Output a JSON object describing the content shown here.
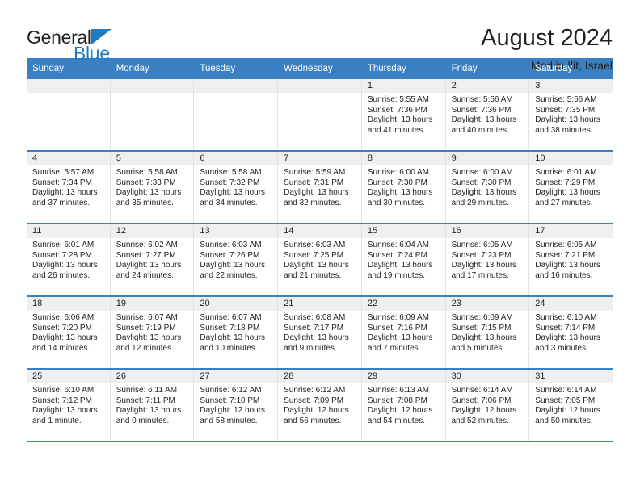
{
  "brand": {
    "name_part1": "General",
    "name_part2": "Blue",
    "triangle_color": "#1f7ac0"
  },
  "header": {
    "title": "August 2024",
    "subtitle": "Modiin Ilit, Israel"
  },
  "theme": {
    "header_blue": "#3a7fc1",
    "day_band_gray": "#efefef",
    "text": "#231f20",
    "cell_border": "#e2e2e2"
  },
  "weekdays": [
    "Sunday",
    "Monday",
    "Tuesday",
    "Wednesday",
    "Thursday",
    "Friday",
    "Saturday"
  ],
  "labels": {
    "sunrise_prefix": "Sunrise: ",
    "sunset_prefix": "Sunset: ",
    "daylight_prefix": "Daylight: "
  },
  "weeks": [
    [
      {
        "day": "",
        "sunrise": "",
        "sunset": "",
        "daylight_line1": "",
        "daylight_line2": ""
      },
      {
        "day": "",
        "sunrise": "",
        "sunset": "",
        "daylight_line1": "",
        "daylight_line2": ""
      },
      {
        "day": "",
        "sunrise": "",
        "sunset": "",
        "daylight_line1": "",
        "daylight_line2": ""
      },
      {
        "day": "",
        "sunrise": "",
        "sunset": "",
        "daylight_line1": "",
        "daylight_line2": ""
      },
      {
        "day": "1",
        "sunrise": "Sunrise: 5:55 AM",
        "sunset": "Sunset: 7:36 PM",
        "daylight_line1": "Daylight: 13 hours",
        "daylight_line2": "and 41 minutes."
      },
      {
        "day": "2",
        "sunrise": "Sunrise: 5:56 AM",
        "sunset": "Sunset: 7:36 PM",
        "daylight_line1": "Daylight: 13 hours",
        "daylight_line2": "and 40 minutes."
      },
      {
        "day": "3",
        "sunrise": "Sunrise: 5:56 AM",
        "sunset": "Sunset: 7:35 PM",
        "daylight_line1": "Daylight: 13 hours",
        "daylight_line2": "and 38 minutes."
      }
    ],
    [
      {
        "day": "4",
        "sunrise": "Sunrise: 5:57 AM",
        "sunset": "Sunset: 7:34 PM",
        "daylight_line1": "Daylight: 13 hours",
        "daylight_line2": "and 37 minutes."
      },
      {
        "day": "5",
        "sunrise": "Sunrise: 5:58 AM",
        "sunset": "Sunset: 7:33 PM",
        "daylight_line1": "Daylight: 13 hours",
        "daylight_line2": "and 35 minutes."
      },
      {
        "day": "6",
        "sunrise": "Sunrise: 5:58 AM",
        "sunset": "Sunset: 7:32 PM",
        "daylight_line1": "Daylight: 13 hours",
        "daylight_line2": "and 34 minutes."
      },
      {
        "day": "7",
        "sunrise": "Sunrise: 5:59 AM",
        "sunset": "Sunset: 7:31 PM",
        "daylight_line1": "Daylight: 13 hours",
        "daylight_line2": "and 32 minutes."
      },
      {
        "day": "8",
        "sunrise": "Sunrise: 6:00 AM",
        "sunset": "Sunset: 7:30 PM",
        "daylight_line1": "Daylight: 13 hours",
        "daylight_line2": "and 30 minutes."
      },
      {
        "day": "9",
        "sunrise": "Sunrise: 6:00 AM",
        "sunset": "Sunset: 7:30 PM",
        "daylight_line1": "Daylight: 13 hours",
        "daylight_line2": "and 29 minutes."
      },
      {
        "day": "10",
        "sunrise": "Sunrise: 6:01 AM",
        "sunset": "Sunset: 7:29 PM",
        "daylight_line1": "Daylight: 13 hours",
        "daylight_line2": "and 27 minutes."
      }
    ],
    [
      {
        "day": "11",
        "sunrise": "Sunrise: 6:01 AM",
        "sunset": "Sunset: 7:28 PM",
        "daylight_line1": "Daylight: 13 hours",
        "daylight_line2": "and 26 minutes."
      },
      {
        "day": "12",
        "sunrise": "Sunrise: 6:02 AM",
        "sunset": "Sunset: 7:27 PM",
        "daylight_line1": "Daylight: 13 hours",
        "daylight_line2": "and 24 minutes."
      },
      {
        "day": "13",
        "sunrise": "Sunrise: 6:03 AM",
        "sunset": "Sunset: 7:26 PM",
        "daylight_line1": "Daylight: 13 hours",
        "daylight_line2": "and 22 minutes."
      },
      {
        "day": "14",
        "sunrise": "Sunrise: 6:03 AM",
        "sunset": "Sunset: 7:25 PM",
        "daylight_line1": "Daylight: 13 hours",
        "daylight_line2": "and 21 minutes."
      },
      {
        "day": "15",
        "sunrise": "Sunrise: 6:04 AM",
        "sunset": "Sunset: 7:24 PM",
        "daylight_line1": "Daylight: 13 hours",
        "daylight_line2": "and 19 minutes."
      },
      {
        "day": "16",
        "sunrise": "Sunrise: 6:05 AM",
        "sunset": "Sunset: 7:23 PM",
        "daylight_line1": "Daylight: 13 hours",
        "daylight_line2": "and 17 minutes."
      },
      {
        "day": "17",
        "sunrise": "Sunrise: 6:05 AM",
        "sunset": "Sunset: 7:21 PM",
        "daylight_line1": "Daylight: 13 hours",
        "daylight_line2": "and 16 minutes."
      }
    ],
    [
      {
        "day": "18",
        "sunrise": "Sunrise: 6:06 AM",
        "sunset": "Sunset: 7:20 PM",
        "daylight_line1": "Daylight: 13 hours",
        "daylight_line2": "and 14 minutes."
      },
      {
        "day": "19",
        "sunrise": "Sunrise: 6:07 AM",
        "sunset": "Sunset: 7:19 PM",
        "daylight_line1": "Daylight: 13 hours",
        "daylight_line2": "and 12 minutes."
      },
      {
        "day": "20",
        "sunrise": "Sunrise: 6:07 AM",
        "sunset": "Sunset: 7:18 PM",
        "daylight_line1": "Daylight: 13 hours",
        "daylight_line2": "and 10 minutes."
      },
      {
        "day": "21",
        "sunrise": "Sunrise: 6:08 AM",
        "sunset": "Sunset: 7:17 PM",
        "daylight_line1": "Daylight: 13 hours",
        "daylight_line2": "and 9 minutes."
      },
      {
        "day": "22",
        "sunrise": "Sunrise: 6:09 AM",
        "sunset": "Sunset: 7:16 PM",
        "daylight_line1": "Daylight: 13 hours",
        "daylight_line2": "and 7 minutes."
      },
      {
        "day": "23",
        "sunrise": "Sunrise: 6:09 AM",
        "sunset": "Sunset: 7:15 PM",
        "daylight_line1": "Daylight: 13 hours",
        "daylight_line2": "and 5 minutes."
      },
      {
        "day": "24",
        "sunrise": "Sunrise: 6:10 AM",
        "sunset": "Sunset: 7:14 PM",
        "daylight_line1": "Daylight: 13 hours",
        "daylight_line2": "and 3 minutes."
      }
    ],
    [
      {
        "day": "25",
        "sunrise": "Sunrise: 6:10 AM",
        "sunset": "Sunset: 7:12 PM",
        "daylight_line1": "Daylight: 13 hours",
        "daylight_line2": "and 1 minute."
      },
      {
        "day": "26",
        "sunrise": "Sunrise: 6:11 AM",
        "sunset": "Sunset: 7:11 PM",
        "daylight_line1": "Daylight: 13 hours",
        "daylight_line2": "and 0 minutes."
      },
      {
        "day": "27",
        "sunrise": "Sunrise: 6:12 AM",
        "sunset": "Sunset: 7:10 PM",
        "daylight_line1": "Daylight: 12 hours",
        "daylight_line2": "and 58 minutes."
      },
      {
        "day": "28",
        "sunrise": "Sunrise: 6:12 AM",
        "sunset": "Sunset: 7:09 PM",
        "daylight_line1": "Daylight: 12 hours",
        "daylight_line2": "and 56 minutes."
      },
      {
        "day": "29",
        "sunrise": "Sunrise: 6:13 AM",
        "sunset": "Sunset: 7:08 PM",
        "daylight_line1": "Daylight: 12 hours",
        "daylight_line2": "and 54 minutes."
      },
      {
        "day": "30",
        "sunrise": "Sunrise: 6:14 AM",
        "sunset": "Sunset: 7:06 PM",
        "daylight_line1": "Daylight: 12 hours",
        "daylight_line2": "and 52 minutes."
      },
      {
        "day": "31",
        "sunrise": "Sunrise: 6:14 AM",
        "sunset": "Sunset: 7:05 PM",
        "daylight_line1": "Daylight: 12 hours",
        "daylight_line2": "and 50 minutes."
      }
    ]
  ]
}
